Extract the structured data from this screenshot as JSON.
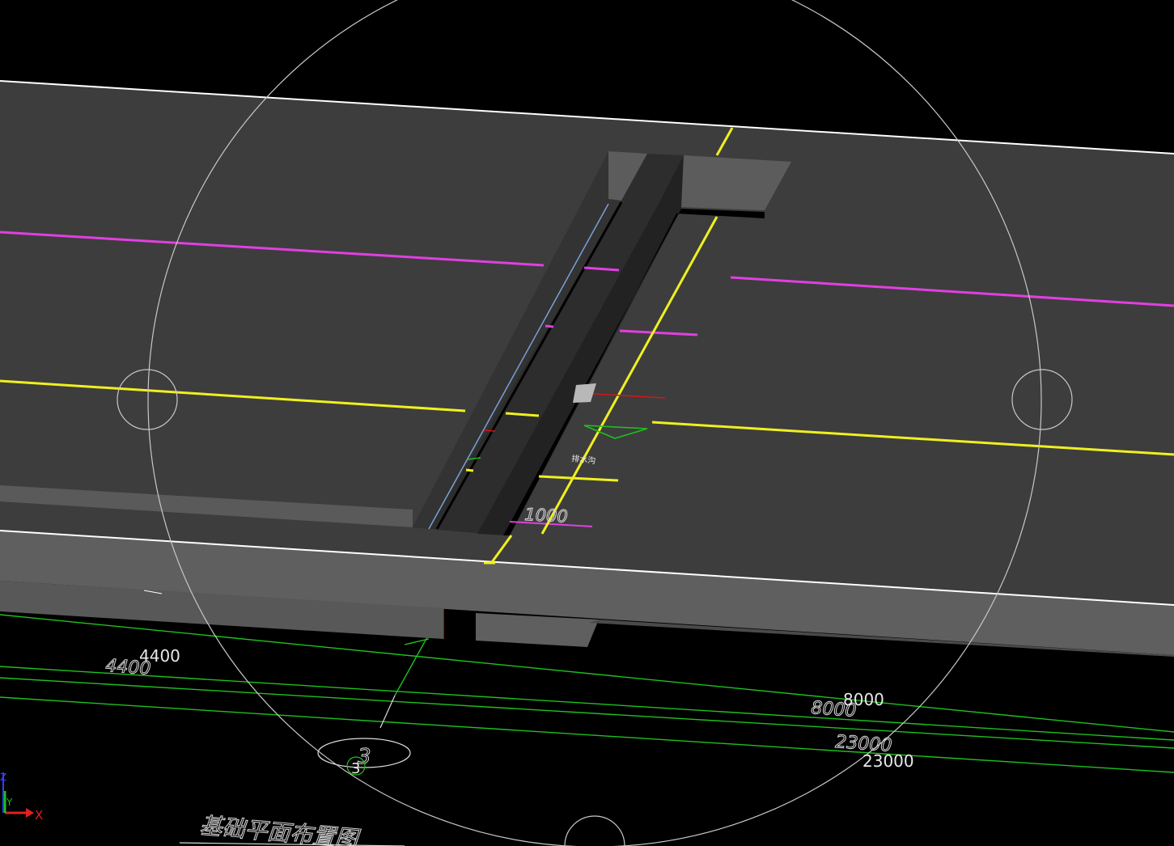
{
  "viewport": {
    "background": "#000000",
    "slab_top_color": "#3d3d3d",
    "slab_face_color": "#5f5f5f",
    "orbit_circle_color": "#c8c8c8",
    "axis_line_colors": {
      "magenta": "#e040e0",
      "yellow": "#f0f020",
      "green": "#1fc01f",
      "red": "#d01818"
    }
  },
  "dimensions": {
    "dim_4400_upright": "4400",
    "dim_4400_italic": "4400",
    "dim_1000_italic": "1000",
    "dim_8000_upright": "8000",
    "dim_8000_italic": "8000",
    "dim_23000_italic": "23000",
    "dim_23000_upright": "23000"
  },
  "labels": {
    "axis_bubble_italic": "3",
    "axis_bubble_upright": "3",
    "drawing_title": "基础平面布置图",
    "trench_note": "排水沟"
  },
  "ucs": {
    "x_label": "X",
    "y_label": "Y",
    "z_label": "Z"
  },
  "icons": {
    "orbit": "3d-orbit-arcball-icon",
    "ucs": "ucs-axis-icon"
  }
}
